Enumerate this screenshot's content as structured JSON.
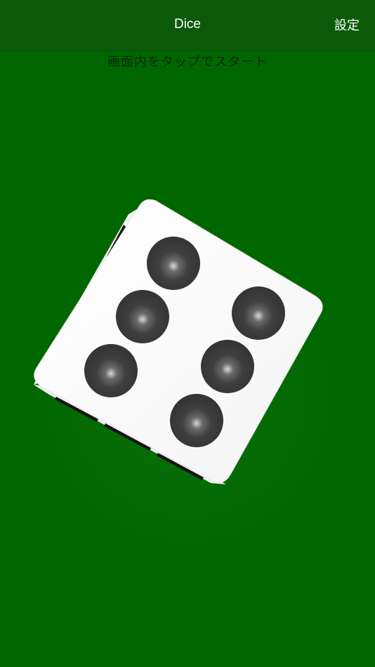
{
  "app": {
    "title": "Dice",
    "settings_label": "設定",
    "hint": "画面内をタップでスタート"
  },
  "colors": {
    "felt": "#006600",
    "navbar": "#0a5a0a",
    "die_face": "#ffffff",
    "pip": "#3a3a3a"
  },
  "die": {
    "face_value": 6,
    "pip_icon": "die-pip"
  }
}
